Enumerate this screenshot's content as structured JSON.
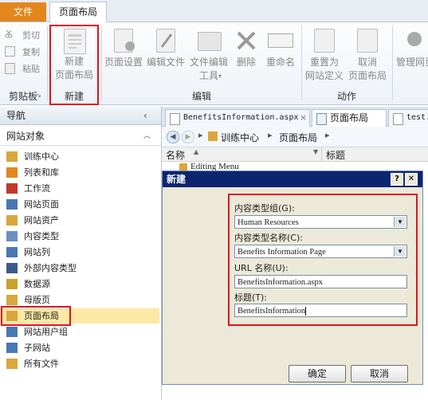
{
  "ribbon": {
    "tabs": [
      "文件",
      "页面布局"
    ],
    "clipboard": {
      "cut": "剪切",
      "copy": "复制",
      "paste": "粘贴",
      "group": "剪贴板"
    },
    "new_group": {
      "button_line1": "新建",
      "button_line2": "页面布局",
      "group": "新建"
    },
    "edit_group": {
      "page_settings": "页面设置",
      "edit_file": "编辑文件",
      "edit_tools_line1": "文件编辑",
      "edit_tools_line2": "工具",
      "delete": "删除",
      "rename": "重命名",
      "group": "编辑"
    },
    "action_group": {
      "reset_line1": "重置为",
      "reset_line2": "网站定义",
      "cancel_line1": "取消",
      "cancel_line2": "页面布局",
      "group": "动作"
    },
    "admin": "管理网页"
  },
  "nav": {
    "header": "导航",
    "section": "网站对象",
    "items": [
      {
        "label": "训练中心",
        "icon": "site-icon"
      },
      {
        "label": "列表和库",
        "icon": "list-icon"
      },
      {
        "label": "工作流",
        "icon": "workflow-icon"
      },
      {
        "label": "网站页面",
        "icon": "page-icon"
      },
      {
        "label": "网站资产",
        "icon": "asset-icon"
      },
      {
        "label": "内容类型",
        "icon": "content-type-icon"
      },
      {
        "label": "网站列",
        "icon": "column-icon"
      },
      {
        "label": "外部内容类型",
        "icon": "external-icon"
      },
      {
        "label": "数据源",
        "icon": "datasource-icon"
      },
      {
        "label": "母版页",
        "icon": "master-icon"
      },
      {
        "label": "页面布局",
        "icon": "layout-icon"
      },
      {
        "label": "网站用户组",
        "icon": "group-icon"
      },
      {
        "label": "子网站",
        "icon": "subsite-icon"
      },
      {
        "label": "所有文件",
        "icon": "folder-icon"
      }
    ]
  },
  "doc_tabs": [
    "BenefitsInformation.aspx",
    "页面布局",
    "test."
  ],
  "breadcrumb": [
    "训练中心",
    "页面布局"
  ],
  "columns": {
    "name": "名称",
    "title": "标题",
    "row": "Editing Menu"
  },
  "dialog": {
    "title": "新建",
    "group_label": "内容类型组(G):",
    "group_value": "Human Resources",
    "name_label": "内容类型名称(C):",
    "name_value": "Benefits Information Page",
    "url_label": "URL 名称(U):",
    "url_value": "BenefitsInformation.aspx",
    "title_label": "标题(T):",
    "title_value": "BenefitsInformation",
    "ok": "确定",
    "cancel": "取消",
    "help": "?",
    "close": "✕"
  },
  "colors": {
    "accent_red": "#e0141e",
    "file_tab": "#e3861c",
    "dialog_title": "#0c2570",
    "selected": "#fde8a5"
  }
}
